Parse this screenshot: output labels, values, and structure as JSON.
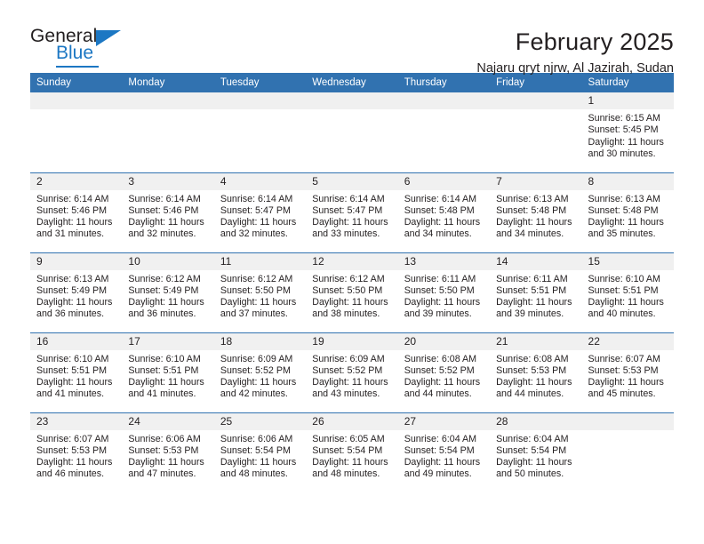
{
  "brand": {
    "name_part1": "General",
    "name_part2": "Blue",
    "accent_color": "#1c77c3"
  },
  "header": {
    "title": "February 2025",
    "location": "Najaru qryt njrw, Al Jazirah, Sudan",
    "header_bg_color": "#3172b0"
  },
  "weekday_headers": [
    "Sunday",
    "Monday",
    "Tuesday",
    "Wednesday",
    "Thursday",
    "Friday",
    "Saturday"
  ],
  "weeks": [
    [
      {
        "day": "",
        "sunrise": "",
        "sunset": "",
        "daylight1": "",
        "daylight2": "",
        "empty": true
      },
      {
        "day": "",
        "sunrise": "",
        "sunset": "",
        "daylight1": "",
        "daylight2": "",
        "empty": true
      },
      {
        "day": "",
        "sunrise": "",
        "sunset": "",
        "daylight1": "",
        "daylight2": "",
        "empty": true
      },
      {
        "day": "",
        "sunrise": "",
        "sunset": "",
        "daylight1": "",
        "daylight2": "",
        "empty": true
      },
      {
        "day": "",
        "sunrise": "",
        "sunset": "",
        "daylight1": "",
        "daylight2": "",
        "empty": true
      },
      {
        "day": "",
        "sunrise": "",
        "sunset": "",
        "daylight1": "",
        "daylight2": "",
        "empty": true
      },
      {
        "day": "1",
        "sunrise": "Sunrise: 6:15 AM",
        "sunset": "Sunset: 5:45 PM",
        "daylight1": "Daylight: 11 hours",
        "daylight2": "and 30 minutes.",
        "empty": false
      }
    ],
    [
      {
        "day": "2",
        "sunrise": "Sunrise: 6:14 AM",
        "sunset": "Sunset: 5:46 PM",
        "daylight1": "Daylight: 11 hours",
        "daylight2": "and 31 minutes.",
        "empty": false
      },
      {
        "day": "3",
        "sunrise": "Sunrise: 6:14 AM",
        "sunset": "Sunset: 5:46 PM",
        "daylight1": "Daylight: 11 hours",
        "daylight2": "and 32 minutes.",
        "empty": false
      },
      {
        "day": "4",
        "sunrise": "Sunrise: 6:14 AM",
        "sunset": "Sunset: 5:47 PM",
        "daylight1": "Daylight: 11 hours",
        "daylight2": "and 32 minutes.",
        "empty": false
      },
      {
        "day": "5",
        "sunrise": "Sunrise: 6:14 AM",
        "sunset": "Sunset: 5:47 PM",
        "daylight1": "Daylight: 11 hours",
        "daylight2": "and 33 minutes.",
        "empty": false
      },
      {
        "day": "6",
        "sunrise": "Sunrise: 6:14 AM",
        "sunset": "Sunset: 5:48 PM",
        "daylight1": "Daylight: 11 hours",
        "daylight2": "and 34 minutes.",
        "empty": false
      },
      {
        "day": "7",
        "sunrise": "Sunrise: 6:13 AM",
        "sunset": "Sunset: 5:48 PM",
        "daylight1": "Daylight: 11 hours",
        "daylight2": "and 34 minutes.",
        "empty": false
      },
      {
        "day": "8",
        "sunrise": "Sunrise: 6:13 AM",
        "sunset": "Sunset: 5:48 PM",
        "daylight1": "Daylight: 11 hours",
        "daylight2": "and 35 minutes.",
        "empty": false
      }
    ],
    [
      {
        "day": "9",
        "sunrise": "Sunrise: 6:13 AM",
        "sunset": "Sunset: 5:49 PM",
        "daylight1": "Daylight: 11 hours",
        "daylight2": "and 36 minutes.",
        "empty": false
      },
      {
        "day": "10",
        "sunrise": "Sunrise: 6:12 AM",
        "sunset": "Sunset: 5:49 PM",
        "daylight1": "Daylight: 11 hours",
        "daylight2": "and 36 minutes.",
        "empty": false
      },
      {
        "day": "11",
        "sunrise": "Sunrise: 6:12 AM",
        "sunset": "Sunset: 5:50 PM",
        "daylight1": "Daylight: 11 hours",
        "daylight2": "and 37 minutes.",
        "empty": false
      },
      {
        "day": "12",
        "sunrise": "Sunrise: 6:12 AM",
        "sunset": "Sunset: 5:50 PM",
        "daylight1": "Daylight: 11 hours",
        "daylight2": "and 38 minutes.",
        "empty": false
      },
      {
        "day": "13",
        "sunrise": "Sunrise: 6:11 AM",
        "sunset": "Sunset: 5:50 PM",
        "daylight1": "Daylight: 11 hours",
        "daylight2": "and 39 minutes.",
        "empty": false
      },
      {
        "day": "14",
        "sunrise": "Sunrise: 6:11 AM",
        "sunset": "Sunset: 5:51 PM",
        "daylight1": "Daylight: 11 hours",
        "daylight2": "and 39 minutes.",
        "empty": false
      },
      {
        "day": "15",
        "sunrise": "Sunrise: 6:10 AM",
        "sunset": "Sunset: 5:51 PM",
        "daylight1": "Daylight: 11 hours",
        "daylight2": "and 40 minutes.",
        "empty": false
      }
    ],
    [
      {
        "day": "16",
        "sunrise": "Sunrise: 6:10 AM",
        "sunset": "Sunset: 5:51 PM",
        "daylight1": "Daylight: 11 hours",
        "daylight2": "and 41 minutes.",
        "empty": false
      },
      {
        "day": "17",
        "sunrise": "Sunrise: 6:10 AM",
        "sunset": "Sunset: 5:51 PM",
        "daylight1": "Daylight: 11 hours",
        "daylight2": "and 41 minutes.",
        "empty": false
      },
      {
        "day": "18",
        "sunrise": "Sunrise: 6:09 AM",
        "sunset": "Sunset: 5:52 PM",
        "daylight1": "Daylight: 11 hours",
        "daylight2": "and 42 minutes.",
        "empty": false
      },
      {
        "day": "19",
        "sunrise": "Sunrise: 6:09 AM",
        "sunset": "Sunset: 5:52 PM",
        "daylight1": "Daylight: 11 hours",
        "daylight2": "and 43 minutes.",
        "empty": false
      },
      {
        "day": "20",
        "sunrise": "Sunrise: 6:08 AM",
        "sunset": "Sunset: 5:52 PM",
        "daylight1": "Daylight: 11 hours",
        "daylight2": "and 44 minutes.",
        "empty": false
      },
      {
        "day": "21",
        "sunrise": "Sunrise: 6:08 AM",
        "sunset": "Sunset: 5:53 PM",
        "daylight1": "Daylight: 11 hours",
        "daylight2": "and 44 minutes.",
        "empty": false
      },
      {
        "day": "22",
        "sunrise": "Sunrise: 6:07 AM",
        "sunset": "Sunset: 5:53 PM",
        "daylight1": "Daylight: 11 hours",
        "daylight2": "and 45 minutes.",
        "empty": false
      }
    ],
    [
      {
        "day": "23",
        "sunrise": "Sunrise: 6:07 AM",
        "sunset": "Sunset: 5:53 PM",
        "daylight1": "Daylight: 11 hours",
        "daylight2": "and 46 minutes.",
        "empty": false
      },
      {
        "day": "24",
        "sunrise": "Sunrise: 6:06 AM",
        "sunset": "Sunset: 5:53 PM",
        "daylight1": "Daylight: 11 hours",
        "daylight2": "and 47 minutes.",
        "empty": false
      },
      {
        "day": "25",
        "sunrise": "Sunrise: 6:06 AM",
        "sunset": "Sunset: 5:54 PM",
        "daylight1": "Daylight: 11 hours",
        "daylight2": "and 48 minutes.",
        "empty": false
      },
      {
        "day": "26",
        "sunrise": "Sunrise: 6:05 AM",
        "sunset": "Sunset: 5:54 PM",
        "daylight1": "Daylight: 11 hours",
        "daylight2": "and 48 minutes.",
        "empty": false
      },
      {
        "day": "27",
        "sunrise": "Sunrise: 6:04 AM",
        "sunset": "Sunset: 5:54 PM",
        "daylight1": "Daylight: 11 hours",
        "daylight2": "and 49 minutes.",
        "empty": false
      },
      {
        "day": "28",
        "sunrise": "Sunrise: 6:04 AM",
        "sunset": "Sunset: 5:54 PM",
        "daylight1": "Daylight: 11 hours",
        "daylight2": "and 50 minutes.",
        "empty": false
      },
      {
        "day": "",
        "sunrise": "",
        "sunset": "",
        "daylight1": "",
        "daylight2": "",
        "empty": true
      }
    ]
  ]
}
